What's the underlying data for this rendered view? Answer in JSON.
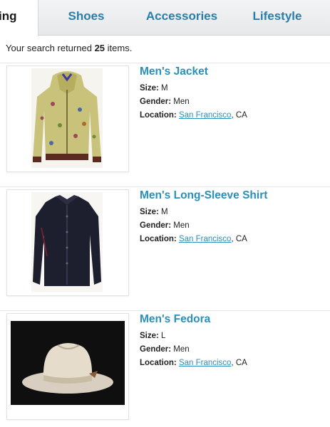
{
  "tabs": [
    {
      "label": "ing",
      "active": true
    },
    {
      "label": "Shoes",
      "active": false
    },
    {
      "label": "Accessories",
      "active": false
    },
    {
      "label": "Lifestyle",
      "active": false
    }
  ],
  "summary": {
    "prefix": "Your search returned",
    "count": "25",
    "suffix": "items."
  },
  "results": [
    {
      "title": "Men's Jacket",
      "size_key": "Size:",
      "size_value": "M",
      "gender_key": "Gender:",
      "gender_value": "Men",
      "location_key": "Location:",
      "location_link": "San Francisco",
      "location_suffix": ", CA",
      "image": "jacket-photo"
    },
    {
      "title": "Men's Long-Sleeve Shirt",
      "size_key": "Size:",
      "size_value": "M",
      "gender_key": "Gender:",
      "gender_value": "Men",
      "location_key": "Location:",
      "location_link": "San Francisco",
      "location_suffix": ", CA",
      "image": "shirt-photo"
    },
    {
      "title": "Men's Fedora",
      "size_key": "Size:",
      "size_value": "L",
      "gender_key": "Gender:",
      "gender_value": "Men",
      "location_key": "Location:",
      "location_link": "San Francisco",
      "location_suffix": ", CA",
      "image": "fedora-photo"
    }
  ],
  "colors": {
    "link": "#2a8fba",
    "tab_text": "#2a7ea9",
    "tabbar_bg": "#e9ebed"
  }
}
